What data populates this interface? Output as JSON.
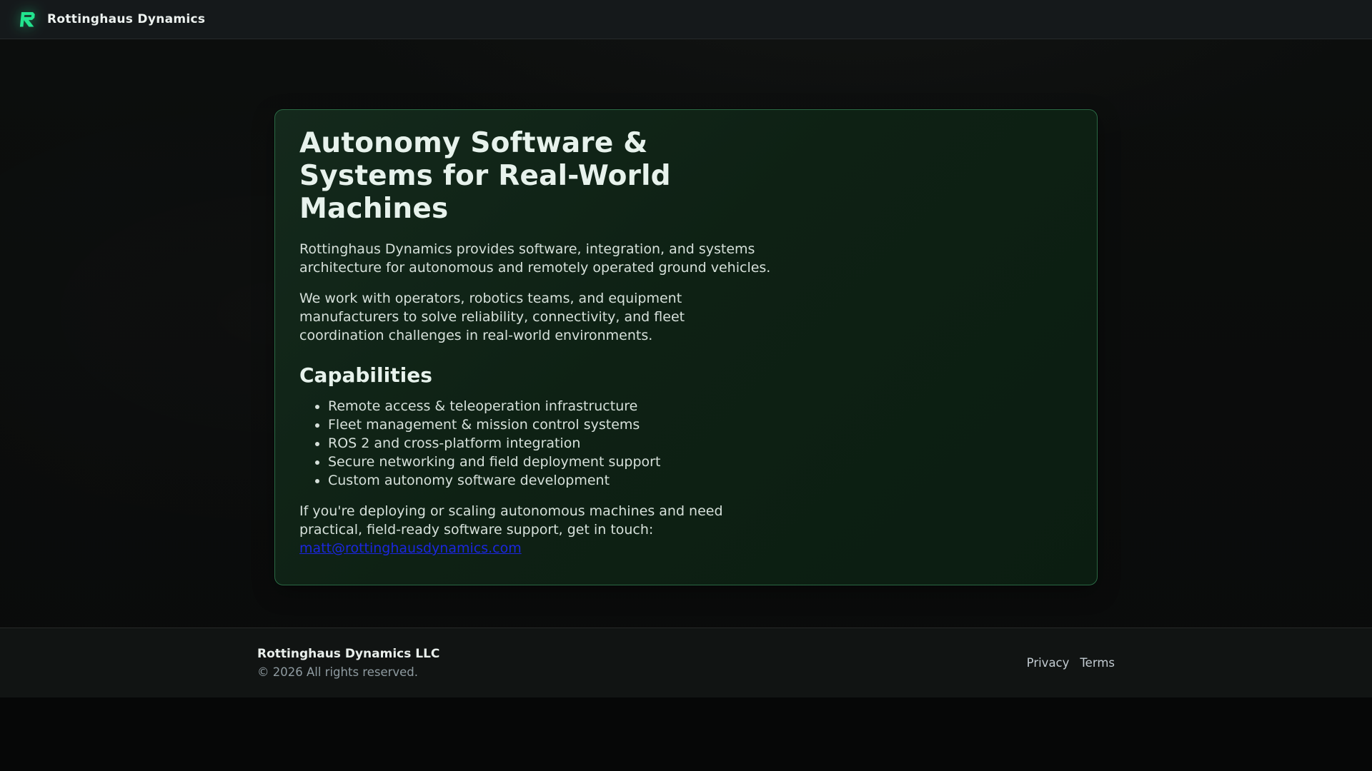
{
  "brand": {
    "name": "Rottinghaus Dynamics"
  },
  "icons": {
    "brand_logo": "stylized-green-R-glyph"
  },
  "hero": {
    "title": "Autonomy Software & Systems for Real-World Machines",
    "intro": "Rottinghaus Dynamics provides software, integration, and systems architecture for autonomous and remotely operated ground vehicles.",
    "body": "We work with operators, robotics teams, and equipment manufacturers to solve reliability, connectivity, and fleet coordination challenges in real-world environments.",
    "capabilities_heading": "Capabilities",
    "capabilities": [
      "Remote access & teleoperation infrastructure",
      "Fleet management & mission control systems",
      "ROS 2 and cross-platform integration",
      "Secure networking and field deployment support",
      "Custom autonomy software development"
    ],
    "contact_prefix": "If you're deploying or scaling autonomous machines and need practical, field-ready software support, get in touch: ",
    "contact_email": "matt@rottinghausdynamics.com"
  },
  "footer": {
    "company": "Rottinghaus Dynamics LLC",
    "copyright": "© 2026 All rights reserved.",
    "links": [
      {
        "label": "Privacy"
      },
      {
        "label": "Terms"
      }
    ]
  },
  "colors": {
    "accent_green": "#22e58f",
    "card_background": "#0e2114",
    "card_border": "#2b6a45",
    "link_blue": "#1b27df",
    "navbar_background": "#15191b"
  }
}
